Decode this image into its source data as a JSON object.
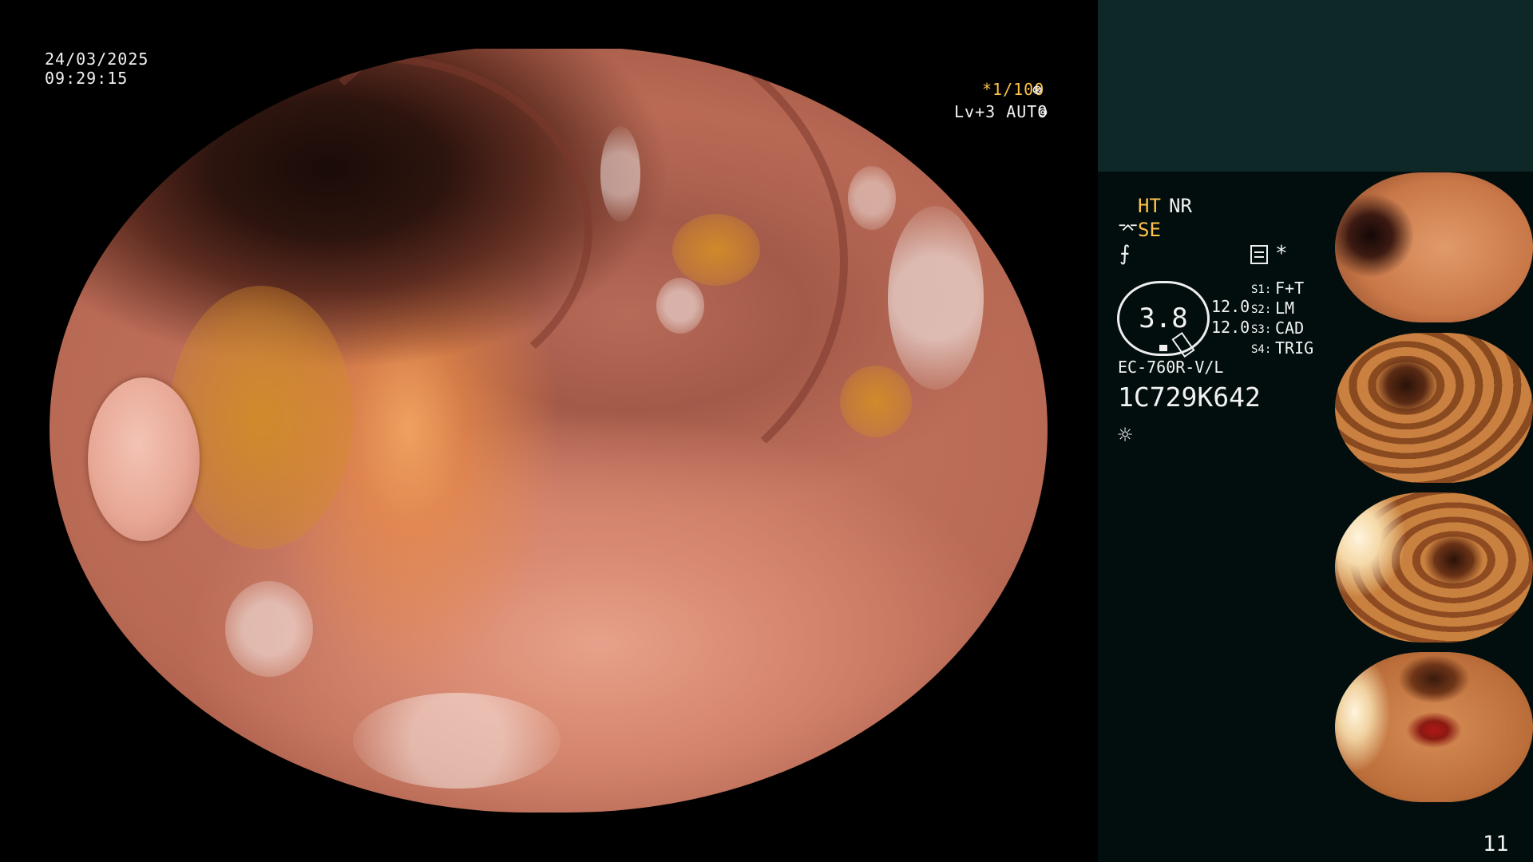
{
  "overlay": {
    "date": "24/03/2025",
    "time": "09:29:15",
    "shutter": "*1/100",
    "shutter_icon": "⊛",
    "level": "Lv+3 AUTO",
    "level_icon": "⊚"
  },
  "panel": {
    "ht": "HT",
    "nr": "NR",
    "se_icon": "⌤",
    "se": "SE",
    "freeze_icon": "⨍",
    "asterisk": "*",
    "gauge_value": "3.8",
    "gauge_val1": "12.0",
    "gauge_val2": "12.0",
    "switches": [
      {
        "label": "S1:",
        "value": "F+T"
      },
      {
        "label": "S2:",
        "value": "LM"
      },
      {
        "label": "S3:",
        "value": "CAD"
      },
      {
        "label": "S4:",
        "value": "TRIG"
      }
    ],
    "scope_model": "EC-760R-V/L",
    "scope_serial": "1C729K642",
    "light_icon": "☼"
  },
  "thumbnails": [
    {
      "id": "1C729K642"
    },
    {
      "id": "1C729K642"
    },
    {
      "id": "1C729K642"
    },
    {
      "id": "1C729K642"
    }
  ],
  "page_number": "11",
  "colors": {
    "accent_yellow": "#ffc24a",
    "panel_top": "#0e2727",
    "panel_bg": "#020e0e"
  }
}
